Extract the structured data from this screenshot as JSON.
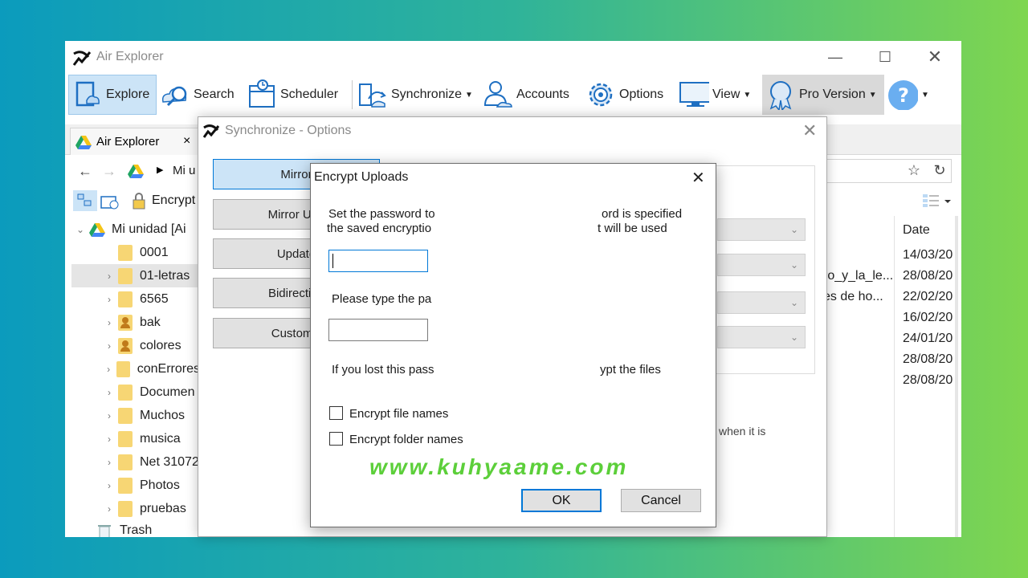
{
  "window": {
    "title": "Air Explorer"
  },
  "toolbar": {
    "explore": "Explore",
    "search": "Search",
    "scheduler": "Scheduler",
    "synchronize": "Synchronize",
    "accounts": "Accounts",
    "options": "Options",
    "view": "View",
    "pro_version": "Pro Version"
  },
  "tab": {
    "label": "Air Explorer",
    "close": "×"
  },
  "nav": {
    "path": "Mi u",
    "encrypt": "Encrypt"
  },
  "tree": {
    "root": "Mi unidad [Ai",
    "items": [
      {
        "label": "0001"
      },
      {
        "label": "01-letras"
      },
      {
        "label": "6565"
      },
      {
        "label": "bak"
      },
      {
        "label": "colores"
      },
      {
        "label": "conErrores"
      },
      {
        "label": "Documen"
      },
      {
        "label": "Muchos"
      },
      {
        "label": "musica"
      },
      {
        "label": "Net 31072"
      },
      {
        "label": "Photos"
      },
      {
        "label": "pruebas"
      }
    ],
    "trash": "Trash"
  },
  "filelist": {
    "date_header": "Date",
    "names": [
      "ro_y_la_le...",
      "es de ho..."
    ],
    "dates": [
      "14/03/20",
      "28/08/20",
      "22/02/20",
      "16/02/20",
      "24/01/20",
      "28/08/20",
      "28/08/20"
    ]
  },
  "sync_dialog": {
    "title": "Synchronize - Options",
    "buttons": [
      "Mirror",
      "Mirror Upd",
      "Update",
      "Bidirection",
      "Customiz"
    ],
    "side_text": "when it is"
  },
  "encrypt_dialog": {
    "title": "Encrypt Uploads",
    "close": "✕",
    "line1_left": "Set the password to",
    "line1_right": "ord is specified",
    "line2_left": "the saved encryptio",
    "line2_right": "t will be used",
    "retype_label": "Please type the pa",
    "lost_left": "If you lost this pass",
    "lost_right": "ypt the files",
    "encrypt_file_names": "Encrypt file names",
    "encrypt_folder_names": "Encrypt folder names",
    "ok": "OK",
    "cancel": "Cancel"
  },
  "watermark": "www.kuhyaame.com",
  "colors": {
    "accent": "#0078d7",
    "folder": "#f7d674",
    "watermark": "#5ccf3a"
  }
}
